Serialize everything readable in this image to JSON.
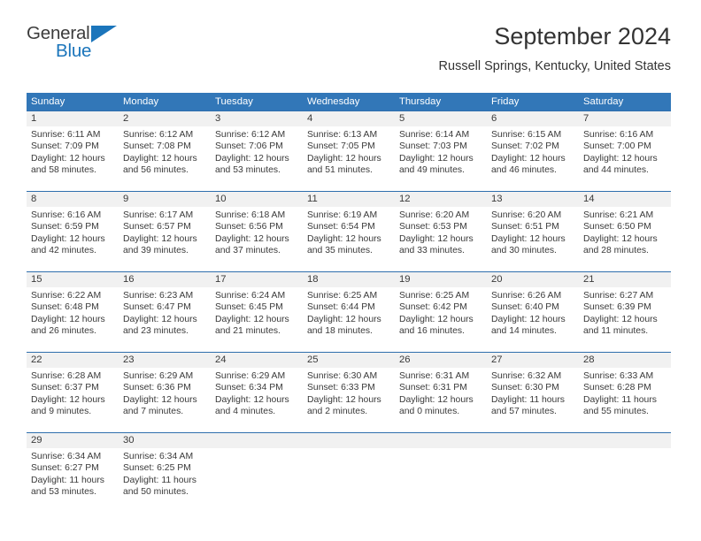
{
  "logo": {
    "part1": "General",
    "part2": "Blue",
    "accent_color": "#1b75bb",
    "triangle_icon": "blue-triangle-icon"
  },
  "header": {
    "title": "September 2024",
    "subtitle": "Russell Springs, Kentucky, United States"
  },
  "theme": {
    "header_blue": "#3277b8",
    "row_divider_blue": "#2f6fad",
    "daynum_band": "#f1f1f1"
  },
  "weekdays": [
    "Sunday",
    "Monday",
    "Tuesday",
    "Wednesday",
    "Thursday",
    "Friday",
    "Saturday"
  ],
  "weeks": [
    [
      {
        "day": "1",
        "sunrise": "Sunrise: 6:11 AM",
        "sunset": "Sunset: 7:09 PM",
        "daylight_1": "Daylight: 12 hours",
        "daylight_2": "and 58 minutes."
      },
      {
        "day": "2",
        "sunrise": "Sunrise: 6:12 AM",
        "sunset": "Sunset: 7:08 PM",
        "daylight_1": "Daylight: 12 hours",
        "daylight_2": "and 56 minutes."
      },
      {
        "day": "3",
        "sunrise": "Sunrise: 6:12 AM",
        "sunset": "Sunset: 7:06 PM",
        "daylight_1": "Daylight: 12 hours",
        "daylight_2": "and 53 minutes."
      },
      {
        "day": "4",
        "sunrise": "Sunrise: 6:13 AM",
        "sunset": "Sunset: 7:05 PM",
        "daylight_1": "Daylight: 12 hours",
        "daylight_2": "and 51 minutes."
      },
      {
        "day": "5",
        "sunrise": "Sunrise: 6:14 AM",
        "sunset": "Sunset: 7:03 PM",
        "daylight_1": "Daylight: 12 hours",
        "daylight_2": "and 49 minutes."
      },
      {
        "day": "6",
        "sunrise": "Sunrise: 6:15 AM",
        "sunset": "Sunset: 7:02 PM",
        "daylight_1": "Daylight: 12 hours",
        "daylight_2": "and 46 minutes."
      },
      {
        "day": "7",
        "sunrise": "Sunrise: 6:16 AM",
        "sunset": "Sunset: 7:00 PM",
        "daylight_1": "Daylight: 12 hours",
        "daylight_2": "and 44 minutes."
      }
    ],
    [
      {
        "day": "8",
        "sunrise": "Sunrise: 6:16 AM",
        "sunset": "Sunset: 6:59 PM",
        "daylight_1": "Daylight: 12 hours",
        "daylight_2": "and 42 minutes."
      },
      {
        "day": "9",
        "sunrise": "Sunrise: 6:17 AM",
        "sunset": "Sunset: 6:57 PM",
        "daylight_1": "Daylight: 12 hours",
        "daylight_2": "and 39 minutes."
      },
      {
        "day": "10",
        "sunrise": "Sunrise: 6:18 AM",
        "sunset": "Sunset: 6:56 PM",
        "daylight_1": "Daylight: 12 hours",
        "daylight_2": "and 37 minutes."
      },
      {
        "day": "11",
        "sunrise": "Sunrise: 6:19 AM",
        "sunset": "Sunset: 6:54 PM",
        "daylight_1": "Daylight: 12 hours",
        "daylight_2": "and 35 minutes."
      },
      {
        "day": "12",
        "sunrise": "Sunrise: 6:20 AM",
        "sunset": "Sunset: 6:53 PM",
        "daylight_1": "Daylight: 12 hours",
        "daylight_2": "and 33 minutes."
      },
      {
        "day": "13",
        "sunrise": "Sunrise: 6:20 AM",
        "sunset": "Sunset: 6:51 PM",
        "daylight_1": "Daylight: 12 hours",
        "daylight_2": "and 30 minutes."
      },
      {
        "day": "14",
        "sunrise": "Sunrise: 6:21 AM",
        "sunset": "Sunset: 6:50 PM",
        "daylight_1": "Daylight: 12 hours",
        "daylight_2": "and 28 minutes."
      }
    ],
    [
      {
        "day": "15",
        "sunrise": "Sunrise: 6:22 AM",
        "sunset": "Sunset: 6:48 PM",
        "daylight_1": "Daylight: 12 hours",
        "daylight_2": "and 26 minutes."
      },
      {
        "day": "16",
        "sunrise": "Sunrise: 6:23 AM",
        "sunset": "Sunset: 6:47 PM",
        "daylight_1": "Daylight: 12 hours",
        "daylight_2": "and 23 minutes."
      },
      {
        "day": "17",
        "sunrise": "Sunrise: 6:24 AM",
        "sunset": "Sunset: 6:45 PM",
        "daylight_1": "Daylight: 12 hours",
        "daylight_2": "and 21 minutes."
      },
      {
        "day": "18",
        "sunrise": "Sunrise: 6:25 AM",
        "sunset": "Sunset: 6:44 PM",
        "daylight_1": "Daylight: 12 hours",
        "daylight_2": "and 18 minutes."
      },
      {
        "day": "19",
        "sunrise": "Sunrise: 6:25 AM",
        "sunset": "Sunset: 6:42 PM",
        "daylight_1": "Daylight: 12 hours",
        "daylight_2": "and 16 minutes."
      },
      {
        "day": "20",
        "sunrise": "Sunrise: 6:26 AM",
        "sunset": "Sunset: 6:40 PM",
        "daylight_1": "Daylight: 12 hours",
        "daylight_2": "and 14 minutes."
      },
      {
        "day": "21",
        "sunrise": "Sunrise: 6:27 AM",
        "sunset": "Sunset: 6:39 PM",
        "daylight_1": "Daylight: 12 hours",
        "daylight_2": "and 11 minutes."
      }
    ],
    [
      {
        "day": "22",
        "sunrise": "Sunrise: 6:28 AM",
        "sunset": "Sunset: 6:37 PM",
        "daylight_1": "Daylight: 12 hours",
        "daylight_2": "and 9 minutes."
      },
      {
        "day": "23",
        "sunrise": "Sunrise: 6:29 AM",
        "sunset": "Sunset: 6:36 PM",
        "daylight_1": "Daylight: 12 hours",
        "daylight_2": "and 7 minutes."
      },
      {
        "day": "24",
        "sunrise": "Sunrise: 6:29 AM",
        "sunset": "Sunset: 6:34 PM",
        "daylight_1": "Daylight: 12 hours",
        "daylight_2": "and 4 minutes."
      },
      {
        "day": "25",
        "sunrise": "Sunrise: 6:30 AM",
        "sunset": "Sunset: 6:33 PM",
        "daylight_1": "Daylight: 12 hours",
        "daylight_2": "and 2 minutes."
      },
      {
        "day": "26",
        "sunrise": "Sunrise: 6:31 AM",
        "sunset": "Sunset: 6:31 PM",
        "daylight_1": "Daylight: 12 hours",
        "daylight_2": "and 0 minutes."
      },
      {
        "day": "27",
        "sunrise": "Sunrise: 6:32 AM",
        "sunset": "Sunset: 6:30 PM",
        "daylight_1": "Daylight: 11 hours",
        "daylight_2": "and 57 minutes."
      },
      {
        "day": "28",
        "sunrise": "Sunrise: 6:33 AM",
        "sunset": "Sunset: 6:28 PM",
        "daylight_1": "Daylight: 11 hours",
        "daylight_2": "and 55 minutes."
      }
    ],
    [
      {
        "day": "29",
        "sunrise": "Sunrise: 6:34 AM",
        "sunset": "Sunset: 6:27 PM",
        "daylight_1": "Daylight: 11 hours",
        "daylight_2": "and 53 minutes."
      },
      {
        "day": "30",
        "sunrise": "Sunrise: 6:34 AM",
        "sunset": "Sunset: 6:25 PM",
        "daylight_1": "Daylight: 11 hours",
        "daylight_2": "and 50 minutes."
      },
      {
        "day": "",
        "sunrise": "",
        "sunset": "",
        "daylight_1": "",
        "daylight_2": ""
      },
      {
        "day": "",
        "sunrise": "",
        "sunset": "",
        "daylight_1": "",
        "daylight_2": ""
      },
      {
        "day": "",
        "sunrise": "",
        "sunset": "",
        "daylight_1": "",
        "daylight_2": ""
      },
      {
        "day": "",
        "sunrise": "",
        "sunset": "",
        "daylight_1": "",
        "daylight_2": ""
      },
      {
        "day": "",
        "sunrise": "",
        "sunset": "",
        "daylight_1": "",
        "daylight_2": ""
      }
    ]
  ]
}
